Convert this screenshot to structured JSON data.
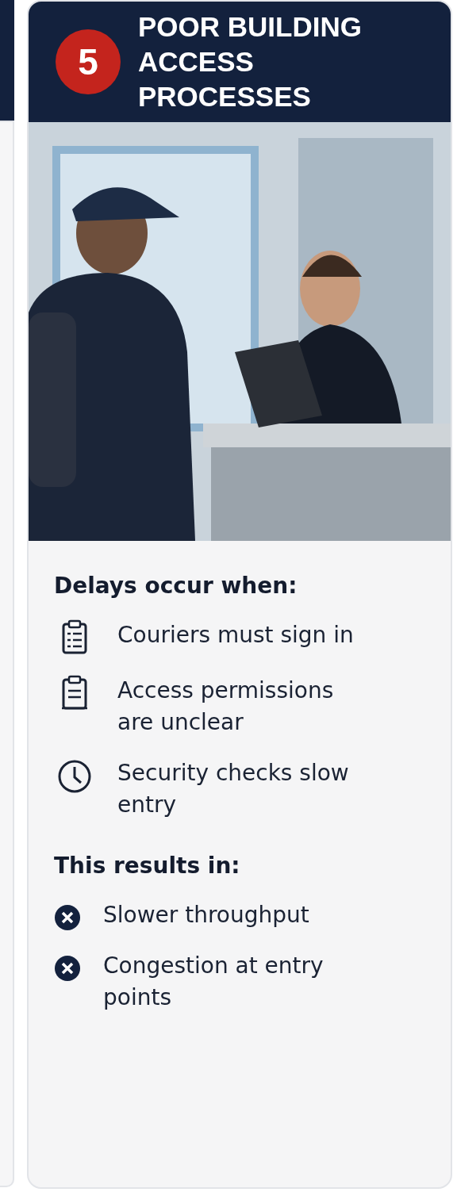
{
  "card": {
    "number": "5",
    "title": "POOR BUILDING ACCESS PROCESSES",
    "sections": [
      {
        "heading": "Delays occur when:",
        "items": [
          {
            "kind": "clipboard-list",
            "text": "Couriers must sign in"
          },
          {
            "kind": "clipboard",
            "text": "Access permissions are unclear"
          },
          {
            "kind": "clock",
            "text": "Security checks slow entry"
          }
        ]
      },
      {
        "heading": "This results in:",
        "items": [
          {
            "kind": "x-circle",
            "text": "Slower throughput"
          },
          {
            "kind": "x-circle",
            "text": "Congestion at entry points"
          }
        ]
      }
    ]
  }
}
